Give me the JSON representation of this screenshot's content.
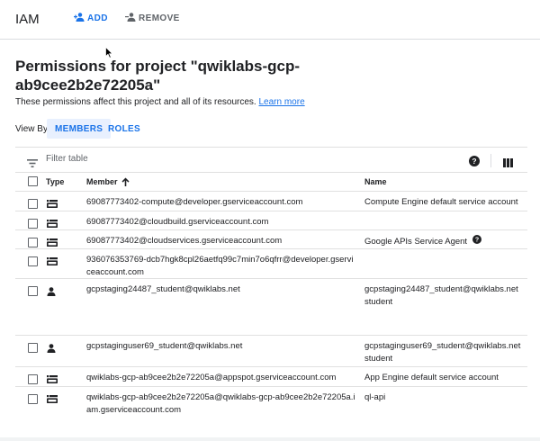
{
  "topbar": {
    "title": "IAM",
    "add_label": "ADD",
    "remove_label": "REMOVE"
  },
  "page": {
    "title": "Permissions for project \"qwiklabs-gcp-ab9cee2b2e72205a\"",
    "subtitle": "These permissions affect this project and all of its resources.",
    "learn_more": "Learn more"
  },
  "view_by": {
    "label": "View By:",
    "members": "MEMBERS",
    "roles": "ROLES",
    "selected": "MEMBERS"
  },
  "filter": {
    "placeholder": "Filter table"
  },
  "table": {
    "headers": {
      "type": "Type",
      "member": "Member",
      "name": "Name"
    },
    "sort": "ascending",
    "rows": [
      {
        "type": "service-account",
        "member": "69087773402-compute@developer.gserviceaccount.com",
        "name": "Compute Engine default service account",
        "has_help": false
      },
      {
        "type": "service-account",
        "member": "69087773402@cloudbuild.gserviceaccount.com",
        "name": "",
        "has_help": false
      },
      {
        "type": "service-account",
        "member": "69087773402@cloudservices.gserviceaccount.com",
        "name": "Google APIs Service Agent",
        "has_help": true
      },
      {
        "type": "service-account",
        "member": "936076353769-dcb7hgk8cpl26aetfq99c7min7o6qfrr@developer.gserviceaccount.com",
        "name": "",
        "has_help": false
      },
      {
        "type": "user",
        "member": "gcpstaging24487_student@qwiklabs.net",
        "name": "gcpstaging24487_student@qwiklabs.net student",
        "has_help": false
      },
      {
        "type": "user",
        "member": "gcpstaginguser69_student@qwiklabs.net",
        "name": "gcpstaginguser69_student@qwiklabs.net student",
        "has_help": false
      },
      {
        "type": "service-account",
        "member": "qwiklabs-gcp-ab9cee2b2e72205a@appspot.gserviceaccount.com",
        "name": "App Engine default service account",
        "has_help": false
      },
      {
        "type": "service-account",
        "member": "qwiklabs-gcp-ab9cee2b2e72205a@qwiklabs-gcp-ab9cee2b2e72205a.iam.gserviceaccount.com",
        "name": "ql-api",
        "has_help": false
      }
    ]
  },
  "colors": {
    "accent": "#1a73e8",
    "selected_bg": "#e8f0fe",
    "divider": "#e0e0e0",
    "muted": "#5f6368"
  }
}
